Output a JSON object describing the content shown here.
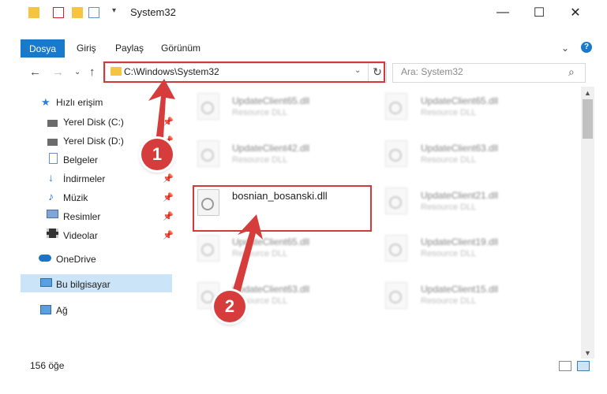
{
  "window": {
    "title": "System32",
    "minimize": "—",
    "maximize": "☐",
    "close": "✕"
  },
  "ribbon": {
    "file_tab": "Dosya",
    "tabs": [
      "Giriş",
      "Paylaş",
      "Görünüm"
    ],
    "expand_glyph": "⌄",
    "help_glyph": "?"
  },
  "address": {
    "path": "C:\\Windows\\System32",
    "search_placeholder": "Ara: System32"
  },
  "nav": {
    "items": [
      {
        "label": "Hızlı erişim",
        "icon": "star-icon"
      },
      {
        "label": "Yerel Disk (C:)",
        "icon": "drive-icon"
      },
      {
        "label": "Yerel Disk (D:)",
        "icon": "drive-icon"
      },
      {
        "label": "Belgeler",
        "icon": "documents-icon"
      },
      {
        "label": "İndirmeler",
        "icon": "download-icon"
      },
      {
        "label": "Müzik",
        "icon": "music-icon"
      },
      {
        "label": "Resimler",
        "icon": "pictures-icon"
      },
      {
        "label": "Videolar",
        "icon": "videos-icon"
      },
      {
        "label": "OneDrive",
        "icon": "cloud-icon"
      },
      {
        "label": "Bu bilgisayar",
        "icon": "computer-icon"
      },
      {
        "label": "Ağ",
        "icon": "network-icon"
      }
    ]
  },
  "files": {
    "left_column": [
      {
        "name": "UpdateClient65.dll",
        "type": "Resource DLL"
      },
      {
        "name": "UpdateClient42.dll",
        "type": "Resource DLL"
      },
      {
        "name": "bosnian_bosanski.dll",
        "type": ""
      },
      {
        "name": "UpdateClient65.dll",
        "type": "Resource DLL"
      },
      {
        "name": "UpdateClient63.dll",
        "type": "Resource DLL"
      }
    ],
    "right_column": [
      {
        "name": "UpdateClient65.dll",
        "type": "Resource DLL"
      },
      {
        "name": "UpdateClient63.dll",
        "type": "Resource DLL"
      },
      {
        "name": "UpdateClient21.dll",
        "type": "Resource DLL"
      },
      {
        "name": "UpdateClient19.dll",
        "type": "Resource DLL"
      },
      {
        "name": "UpdateClient15.dll",
        "type": "Resource DLL"
      }
    ]
  },
  "status": {
    "count": "156 öğe"
  },
  "annotations": {
    "step1": "1",
    "step2": "2",
    "color": "#d63c3c"
  }
}
